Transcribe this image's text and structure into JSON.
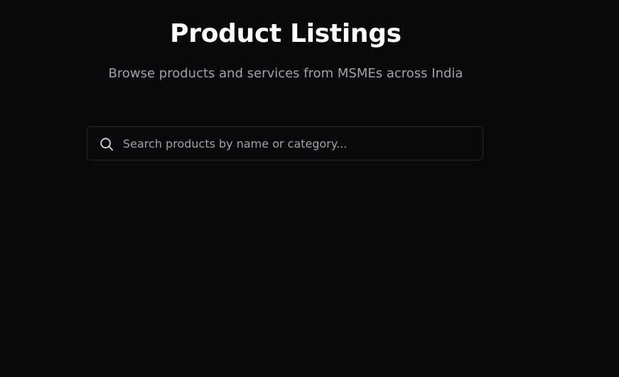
{
  "header": {
    "title": "Product Listings",
    "subtitle": "Browse products and services from MSMEs across India"
  },
  "search": {
    "placeholder": "Search products by name or category...",
    "value": "",
    "icon": "search-icon"
  },
  "colors": {
    "background": "#09090b",
    "title": "#ffffff",
    "subtitle": "#a1a1aa",
    "border": "#27272a"
  }
}
